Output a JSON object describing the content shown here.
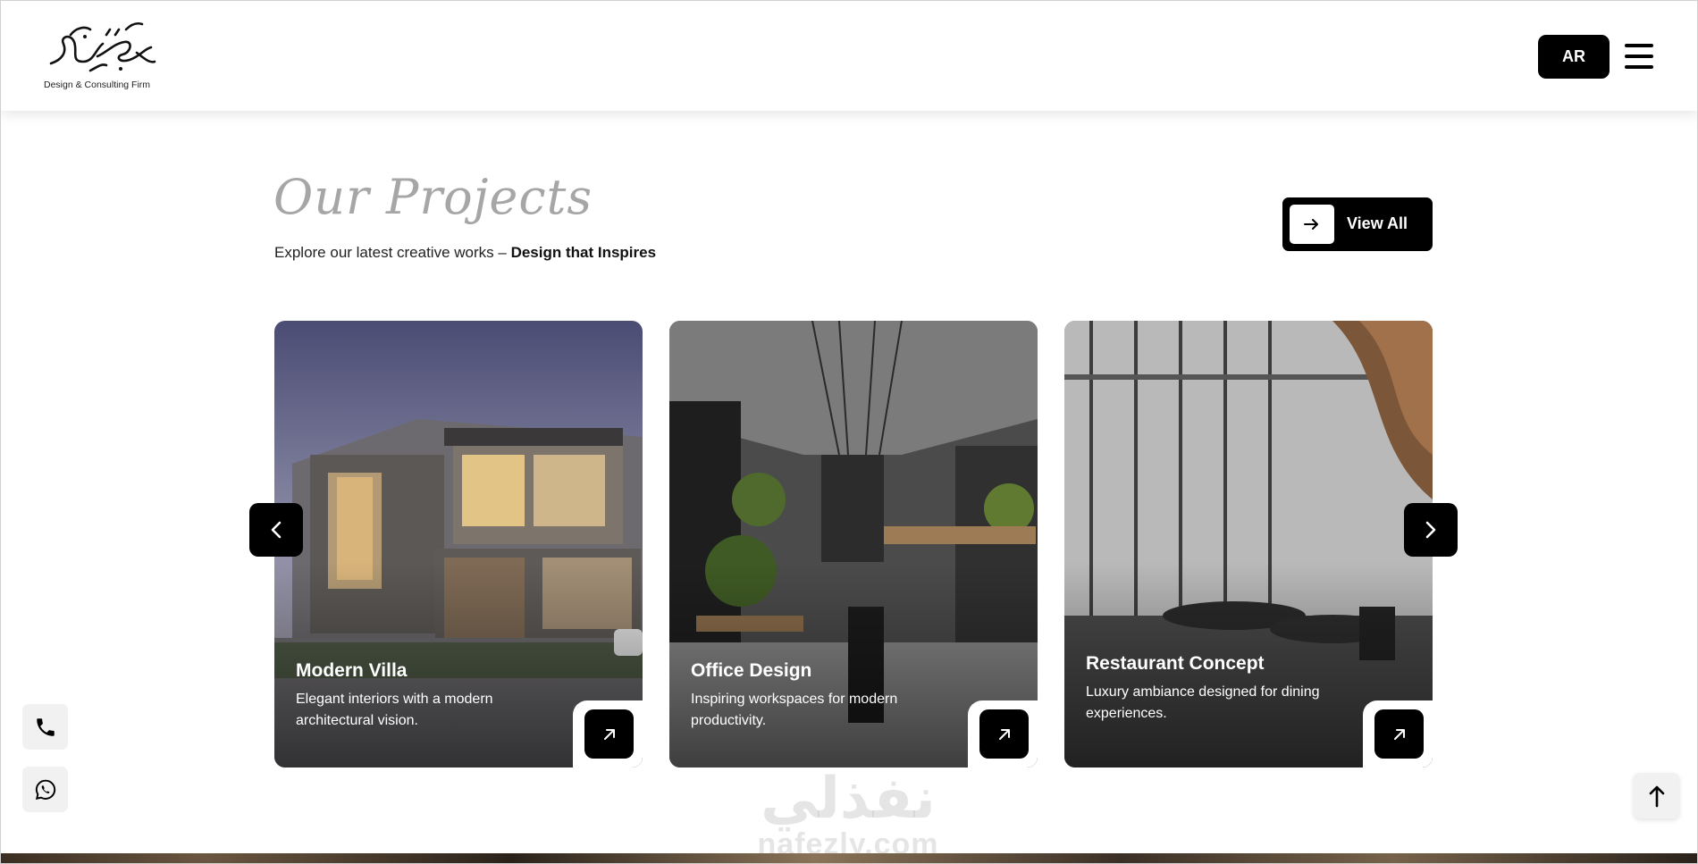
{
  "header": {
    "logo_tagline": "Design & Consulting Firm",
    "lang_label": "AR"
  },
  "projects": {
    "title": "Our Projects",
    "subtitle_plain": "Explore our latest creative works – ",
    "subtitle_bold": "Design that Inspires",
    "view_all_label": "View All",
    "cards": [
      {
        "title": "Modern Villa",
        "description": "Elegant interiors with a modern architectural vision."
      },
      {
        "title": "Office Design",
        "description": "Inspiring workspaces for modern productivity."
      },
      {
        "title": "Restaurant Concept",
        "description": "Luxury ambiance designed for dining experiences."
      }
    ]
  },
  "watermark": {
    "arabic": "نفذلي",
    "latin": "nafezly.com"
  },
  "icons": {
    "menu": "hamburger-icon",
    "view_all": "arrow-right-icon",
    "card_open": "arrow-up-right-icon",
    "prev": "chevron-left-icon",
    "next": "chevron-right-icon",
    "phone": "phone-icon",
    "whatsapp": "whatsapp-icon",
    "scroll_top": "arrow-up-icon"
  },
  "colors": {
    "primary": "#000000",
    "title_gray": "#a6a6a6",
    "float_bg": "#f1f1f1"
  }
}
